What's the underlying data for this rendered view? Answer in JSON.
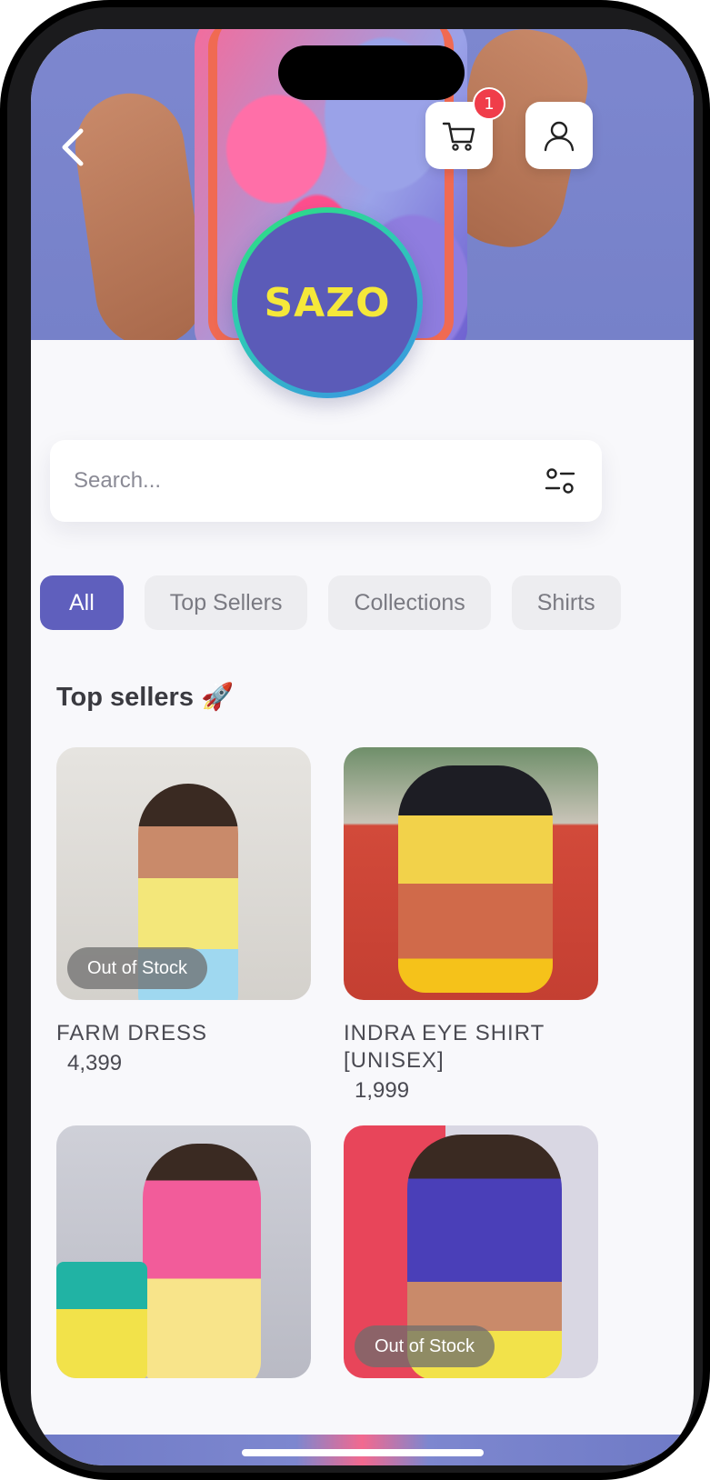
{
  "store": {
    "logo_text": "SAZO",
    "cart_count": "1"
  },
  "search": {
    "placeholder": "Search..."
  },
  "chips": [
    {
      "label": "All",
      "active": true
    },
    {
      "label": "Top Sellers",
      "active": false
    },
    {
      "label": "Collections",
      "active": false
    },
    {
      "label": "Shirts",
      "active": false
    }
  ],
  "section": {
    "title": "Top sellers 🚀"
  },
  "products": [
    {
      "name": "FARM DRESS",
      "price": "4,399",
      "status": "Out of Stock"
    },
    {
      "name": "INDRA EYE SHIRT [UNISEX]",
      "price": "1,999",
      "status": ""
    },
    {
      "name": "",
      "price": "",
      "status": ""
    },
    {
      "name": "",
      "price": "",
      "status": "Out of Stock"
    }
  ],
  "colors": {
    "accent": "#5f5fbd",
    "logo_bg": "#5b5bb8",
    "logo_text": "#f5e83a",
    "badge": "#f03d4a"
  },
  "icons": {
    "back": "chevron-left-icon",
    "cart": "cart-icon",
    "profile": "user-icon",
    "filter": "filter-icon"
  }
}
